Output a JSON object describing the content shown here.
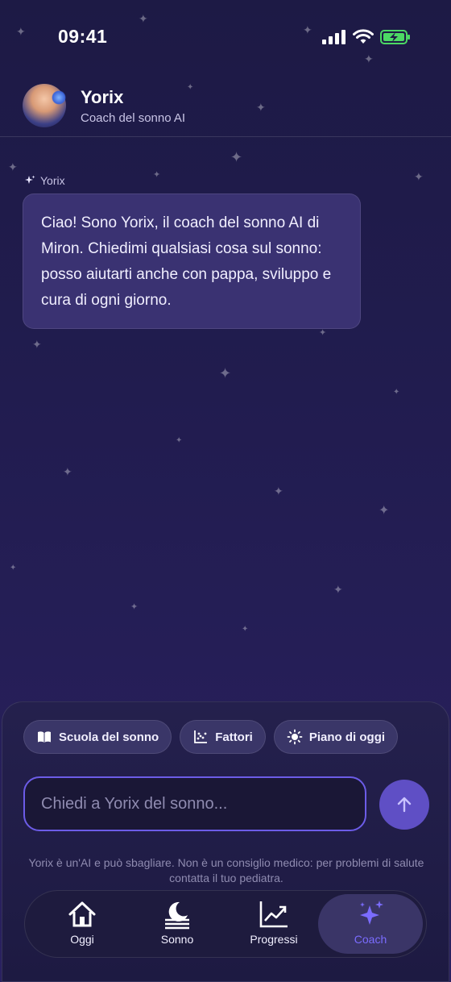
{
  "status_bar": {
    "time": "09:41"
  },
  "header": {
    "title": "Yorix",
    "subtitle": "Coach del sonno AI"
  },
  "chat": {
    "messages": [
      {
        "sender": "Yorix",
        "text": "Ciao! Sono Yorix, il coach del sonno AI di Miron. Chiedimi qualsiasi cosa sul sonno: posso aiutarti anche con pappa, sviluppo e cura di ogni giorno."
      }
    ]
  },
  "quick_actions": [
    {
      "label": "Scuola del sonno",
      "icon": "book-icon"
    },
    {
      "label": "Fattori",
      "icon": "scatter-chart-icon"
    },
    {
      "label": "Piano di oggi",
      "icon": "sun-icon"
    }
  ],
  "input": {
    "placeholder": "Chiedi a Yorix del sonno..."
  },
  "disclaimer": "Yorix è un'AI e può sbagliare. Non è un consiglio medico: per problemi di salute contatta il tuo pediatra.",
  "tabs": [
    {
      "label": "Oggi",
      "icon": "home-icon",
      "active": false
    },
    {
      "label": "Sonno",
      "icon": "moon-icon",
      "active": false
    },
    {
      "label": "Progressi",
      "icon": "chart-icon",
      "active": false
    },
    {
      "label": "Coach",
      "icon": "sparkles-icon",
      "active": true
    }
  ],
  "colors": {
    "accent": "#6c5ce7",
    "active_tab_text": "#7b6cff",
    "background": "#1d1a45"
  }
}
